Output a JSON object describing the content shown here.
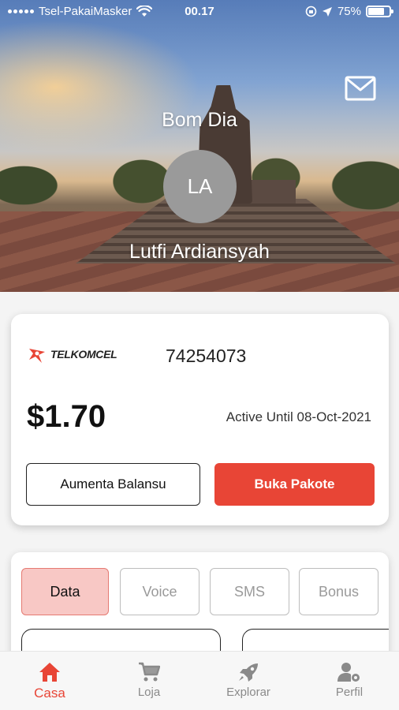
{
  "status_bar": {
    "carrier": "Tsel-PakaiMasker",
    "time": "00.17",
    "battery_percent": "75%",
    "battery_level": 0.75
  },
  "header": {
    "greeting": "Bom Dia",
    "avatar_initials": "LA",
    "user_name": "Lutfi Ardiansyah",
    "mail_icon": "mail-icon"
  },
  "account": {
    "provider": "TELKOMCEL",
    "phone_number": "74254073",
    "balance": "$1.70",
    "active_until": "Active Until 08-Oct-2021",
    "topup_label": "Aumenta Balansu",
    "buy_package_label": "Buka Pakote"
  },
  "packages": {
    "tabs": [
      {
        "label": "Data",
        "active": true
      },
      {
        "label": "Voice",
        "active": false
      },
      {
        "label": "SMS",
        "active": false
      },
      {
        "label": "Bonus",
        "active": false
      }
    ]
  },
  "nav": {
    "items": [
      {
        "label": "Casa",
        "icon": "home-icon",
        "active": true
      },
      {
        "label": "Loja",
        "icon": "cart-icon",
        "active": false
      },
      {
        "label": "Explorar",
        "icon": "rocket-icon",
        "active": false
      },
      {
        "label": "Perfil",
        "icon": "user-settings-icon",
        "active": false
      }
    ]
  },
  "colors": {
    "accent": "#e84536",
    "active_tab_bg": "#f8c8c5"
  }
}
